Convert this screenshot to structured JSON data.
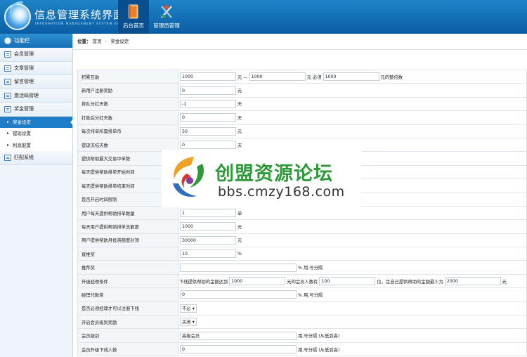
{
  "header": {
    "title": "信息管理系统界面",
    "subtitle": "INFORMATION MANAGEMENT SYSTEM GUI",
    "tabs": [
      {
        "label": "后台首页",
        "icon": "book-icon",
        "active": true
      },
      {
        "label": "管理员管理",
        "icon": "tools-icon",
        "active": false
      }
    ]
  },
  "sidebar": {
    "title": "功能栏",
    "items": [
      {
        "label": "会员管理"
      },
      {
        "label": "文章管理"
      },
      {
        "label": "留言管理"
      },
      {
        "label": "激活码管理"
      },
      {
        "label": "奖金管理"
      }
    ],
    "subitems": [
      {
        "label": "奖金设定",
        "active": true
      },
      {
        "label": "提现设置",
        "active": false
      },
      {
        "label": "利息配置",
        "active": false
      }
    ],
    "last_item": {
      "label": "匹配系统"
    }
  },
  "breadcrumb": {
    "prefix": "位置：",
    "home": "首页",
    "sep": "›",
    "current": "奖金设定"
  },
  "form": {
    "r1": {
      "label": "积累互助",
      "v1": "1000",
      "t1": "元 —",
      "v2": "1000",
      "t2": "元 必须",
      "v3": "1000",
      "t3": "元的整倍数"
    },
    "r2": {
      "label": "新用户注册奖励",
      "v": "0",
      "t": "元"
    },
    "r3": {
      "label": "排队分红天数",
      "v": "-1",
      "t": "天"
    },
    "r4": {
      "label": "打款后分红天数",
      "v": "0",
      "t": "天"
    },
    "r5": {
      "label": "每次排单所需排单币",
      "v": "50",
      "t": "元"
    },
    "r6": {
      "label": "提现冻结天数",
      "v": "0",
      "t": "天"
    },
    "r7": {
      "label": "提供帮助最大交易中单数"
    },
    "r8": {
      "label": "每天提供帮助排单开始时间"
    },
    "r9": {
      "label": "每天提供帮助排单结束时间"
    },
    "r10": {
      "label": "是否开启时间限制"
    },
    "r11": {
      "label": "用户每天提供帮助排单数量",
      "v": "1",
      "t": "单"
    },
    "r12": {
      "label": "每天用户提供帮助排单总额度",
      "v": "1000",
      "t": "元"
    },
    "r13": {
      "label": "用户提供帮助月投资额度封顶",
      "v": "30000",
      "t": "元"
    },
    "r14": {
      "label": "直推奖",
      "v": "10",
      "t": "%"
    },
    "r15": {
      "label": "推荐奖",
      "v": "",
      "t": "% 用,号分隔"
    },
    "r16": {
      "label": "升级经理条件",
      "t1": "下线提供帮助的金额达到",
      "v1": "1000",
      "t2": "元的会员人数有",
      "v2": "100",
      "t3": "位，且自己提供帮助的金额最少为",
      "v3": "2000",
      "t4": "元"
    },
    "r17": {
      "label": "经理代数奖",
      "v": "0",
      "t": "% 用,号分隔"
    },
    "r18": {
      "label": "是否必须经理才可以注册下线",
      "sel": "不必"
    },
    "r19": {
      "label": "开启会员级别奖励",
      "sel": "关闭"
    },
    "r20": {
      "label": "会员级别",
      "v": "高级会员",
      "t": "用,号分隔 (从低到高)"
    },
    "r21": {
      "label": "会员升级下线人数",
      "v": "0",
      "t": "用,号分隔 (从低到高)"
    }
  },
  "watermark": {
    "title": "创盟资源论坛",
    "url": "bbs.cmzy168.com"
  },
  "colors": {
    "header": "#0b5ea3",
    "active_sub": "#1f7cc6",
    "watermark_green": "#2e9a3a"
  }
}
